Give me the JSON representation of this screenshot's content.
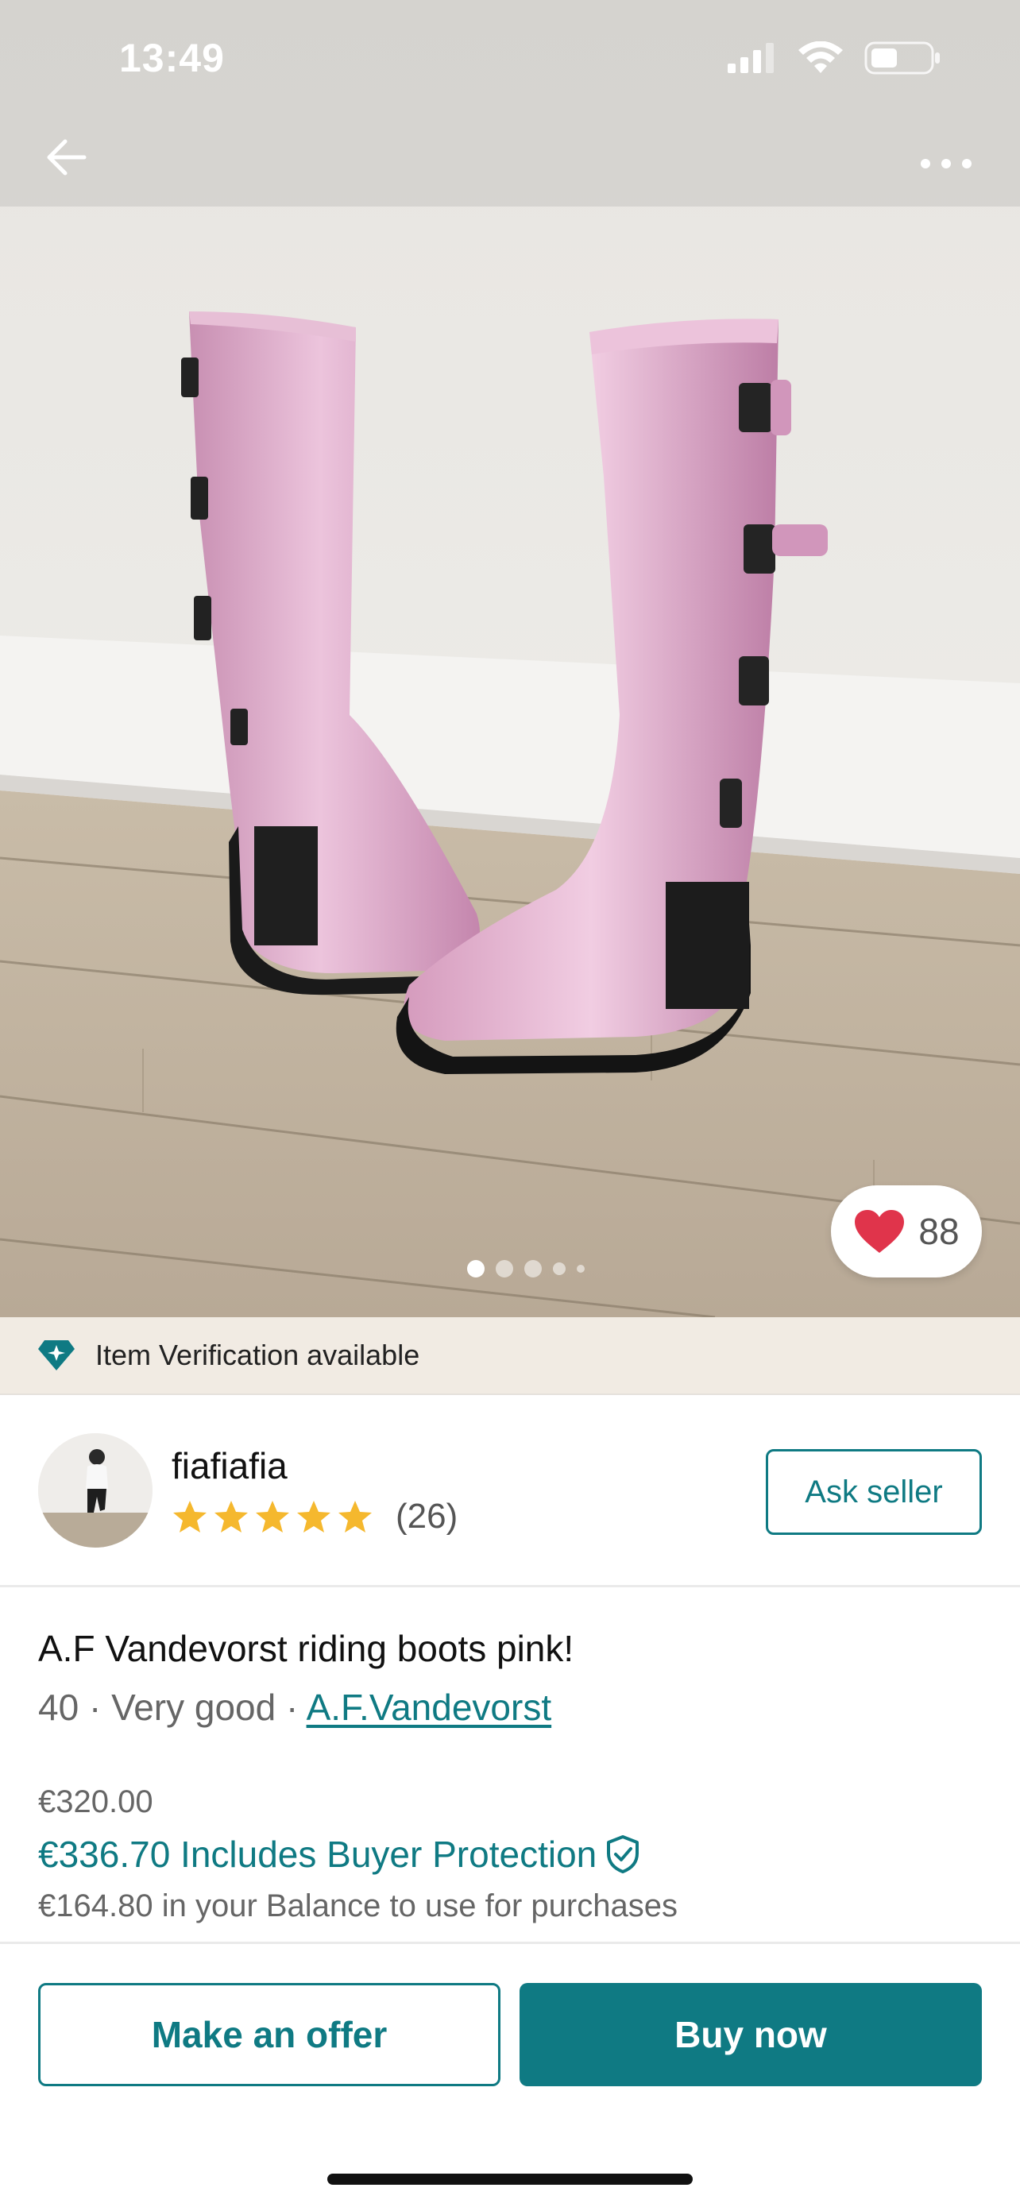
{
  "status_bar": {
    "time": "13:49"
  },
  "listing": {
    "favorites_count": "88",
    "photo_count": 5,
    "active_photo_index": 0
  },
  "verification": {
    "text": "Item Verification available"
  },
  "seller": {
    "username": "fiafiafia",
    "rating_stars": 5,
    "review_count": "(26)",
    "ask_button_label": "Ask seller"
  },
  "item": {
    "title": "A.F Vandevorst riding boots pink!",
    "size": "40",
    "separator": " · ",
    "condition": "Very good",
    "brand": "A.F.Vandevorst",
    "price": "€320.00",
    "price_with_protection": "€336.70 Includes Buyer Protection",
    "balance_note": "€164.80 in your Balance to use for purchases"
  },
  "actions": {
    "offer_label": "Make an offer",
    "buy_label": "Buy now"
  },
  "colors": {
    "accent": "#0f7a83",
    "star": "#f5b82e",
    "heart": "#e0344b",
    "banner_bg": "#f1ebe3"
  },
  "icons": {
    "back": "arrow-left-icon",
    "more": "more-horizontal-icon",
    "favorite": "heart-icon",
    "verify": "diamond-icon",
    "protection": "shield-check-icon"
  }
}
